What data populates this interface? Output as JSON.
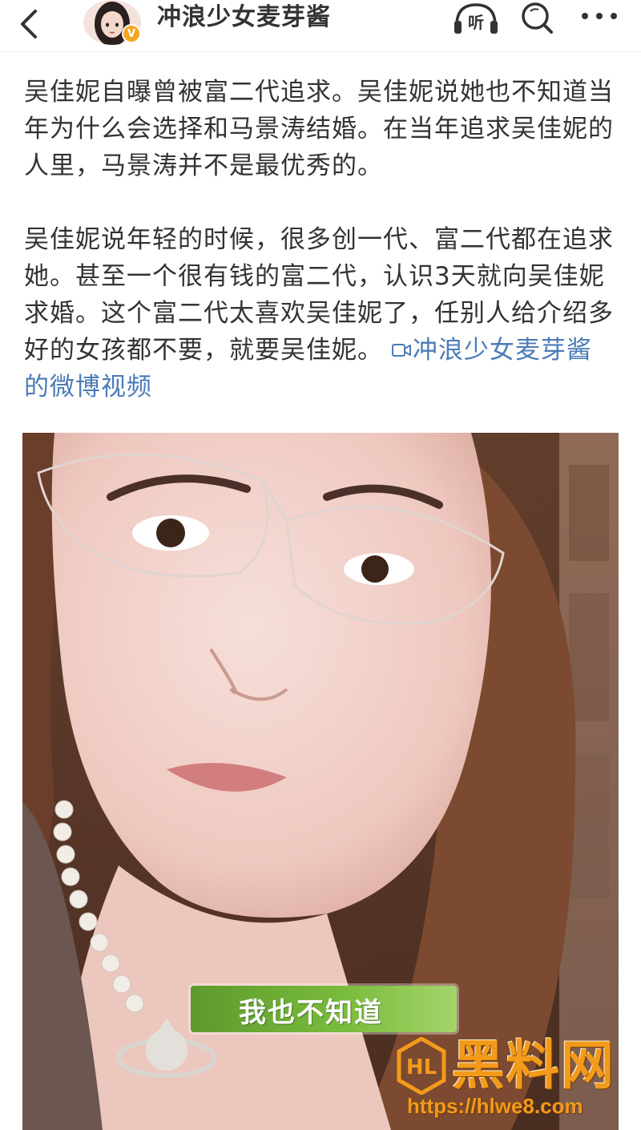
{
  "header": {
    "author_name": "冲浪少女麦芽酱",
    "verified_badge": "V",
    "listen_label": "听",
    "icons": {
      "back": "chevron-left-icon",
      "listen": "headphones-icon",
      "search": "search-icon",
      "more": "more-dots-icon"
    }
  },
  "post": {
    "paragraph1": "吴佳妮自曝曾被富二代追求。吴佳妮说她也不知道当年为什么会选择和马景涛结婚。在当年追求吴佳妮的人里，马景涛并不是最优秀的。",
    "paragraph2": "吴佳妮说年轻的时候，很多创一代、富二代都在追求她。甚至一个很有钱的富二代，认识3天就向吴佳妮求婚。这个富二代太喜欢吴佳妮了，任别人给介绍多好的女孩都不要，就要吴佳妮。",
    "video_link_label": "冲浪少女麦芽酱的微博视频",
    "link_color": "#4a7bb7"
  },
  "video": {
    "subtitle": "我也不知道"
  },
  "watermark": {
    "logo_text": "黑料网",
    "url": "https://hlwe8.com",
    "color": "#f39a1b"
  }
}
